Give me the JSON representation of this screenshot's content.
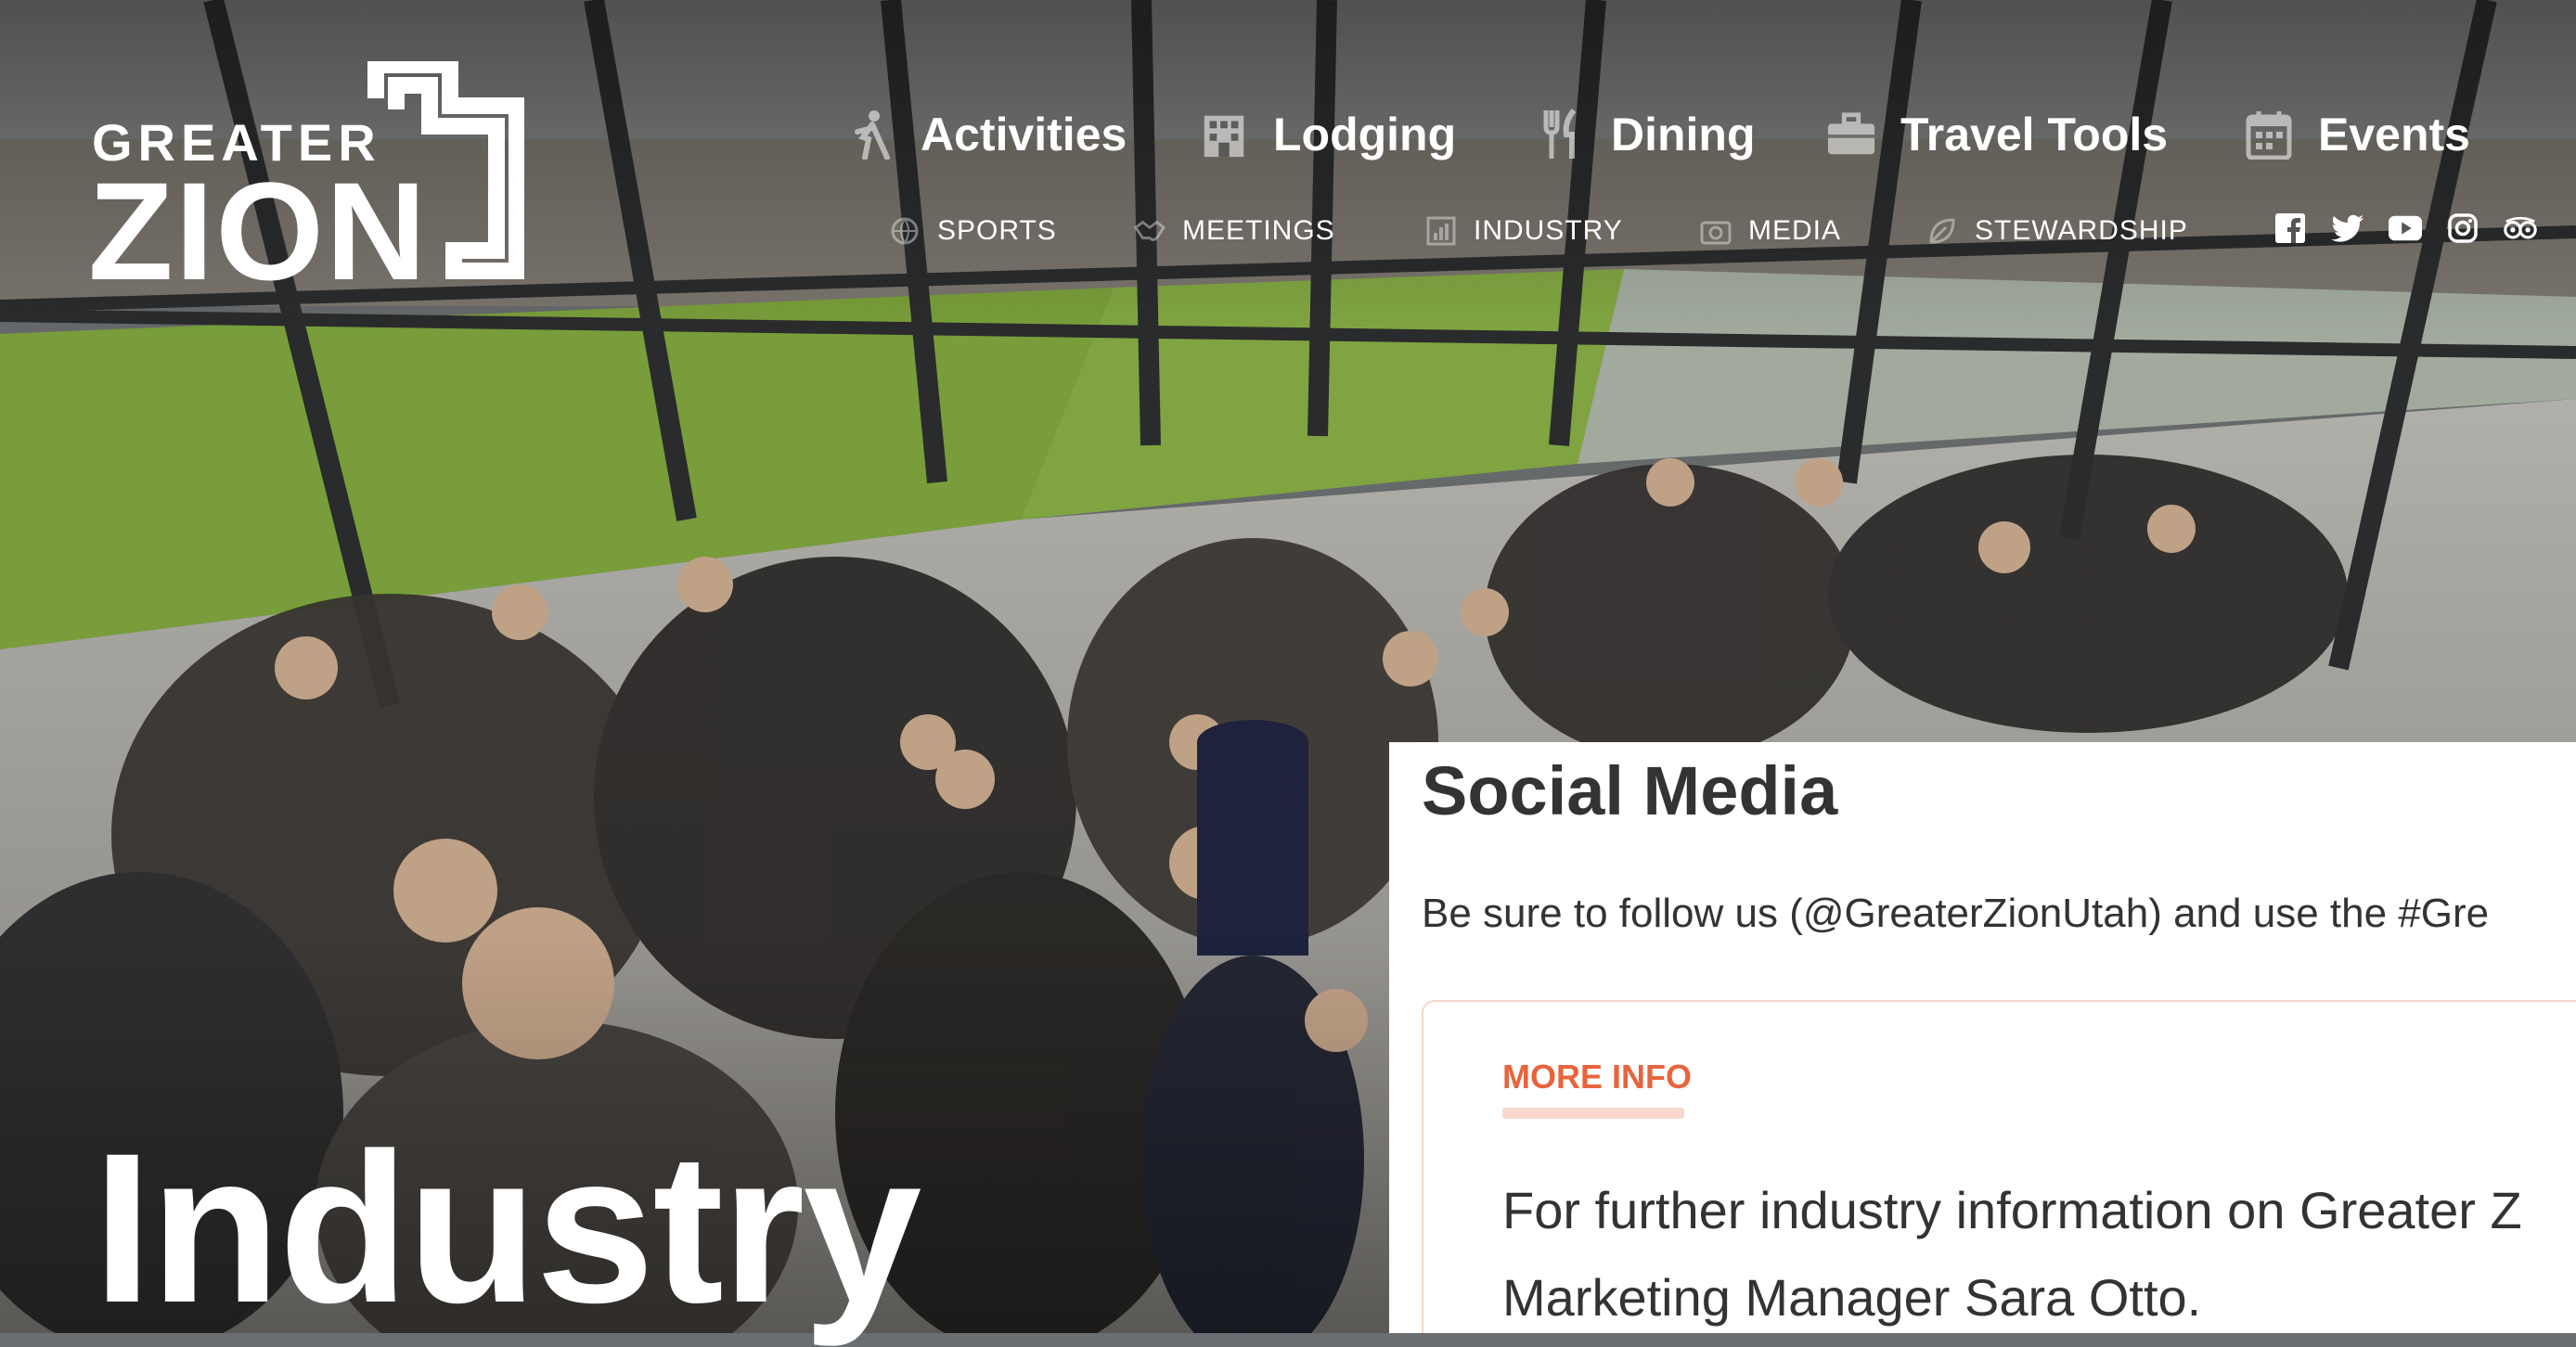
{
  "brand": {
    "line1": "GREATER",
    "line2": "ZION"
  },
  "main_nav": [
    {
      "label": "Activities",
      "icon": "hiker-icon"
    },
    {
      "label": "Lodging",
      "icon": "building-icon"
    },
    {
      "label": "Dining",
      "icon": "fork-knife-icon"
    },
    {
      "label": "Travel Tools",
      "icon": "briefcase-icon"
    },
    {
      "label": "Events",
      "icon": "calendar-icon"
    }
  ],
  "sub_nav": [
    {
      "label": "SPORTS",
      "icon": "ball-icon"
    },
    {
      "label": "MEETINGS",
      "icon": "handshake-icon"
    },
    {
      "label": "INDUSTRY",
      "icon": "chart-icon"
    },
    {
      "label": "MEDIA",
      "icon": "camera-icon"
    },
    {
      "label": "STEWARDSHIP",
      "icon": "leaf-icon"
    }
  ],
  "social": [
    "facebook-icon",
    "twitter-icon",
    "youtube-icon",
    "instagram-icon",
    "tripadvisor-icon"
  ],
  "page_title": "Industry",
  "panel": {
    "heading": "Social Media",
    "intro": "Be sure to follow us (@GreaterZionUtah) and use the #Gre",
    "card_tag": "MORE INFO",
    "card_body_line1": "For further industry information on Greater Z",
    "card_body_line2": "Marketing Manager Sara Otto."
  },
  "colors": {
    "accent": "#e8643c",
    "accent_light": "#f9d7cc",
    "text": "#333333"
  }
}
